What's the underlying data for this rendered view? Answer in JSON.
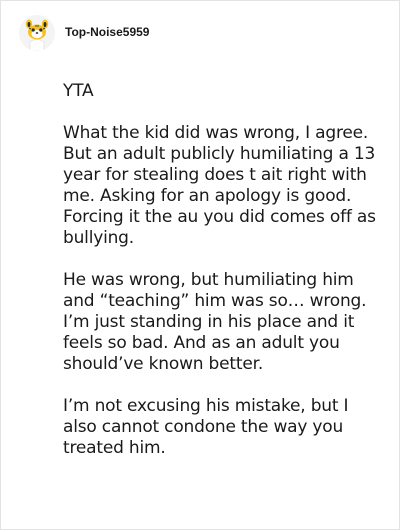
{
  "comment": {
    "username": "Top-Noise5959",
    "avatar_icon": "snoo-avatar-icon",
    "paragraphs": [
      "YTA",
      "What the kid did was wrong, I agree. But an adult publicly humiliating a 13 year for stealing does t ait right with me. Asking for an apology is good. Forcing it the au you did comes off as bullying.",
      "He was wrong, but humiliating him and “teaching” him was so… wrong. I’m just standing in his place and it feels so bad. And as an adult you should’ve known better.",
      "I’m not excusing his mistake, but I also cannot condone the way you treated him."
    ]
  }
}
